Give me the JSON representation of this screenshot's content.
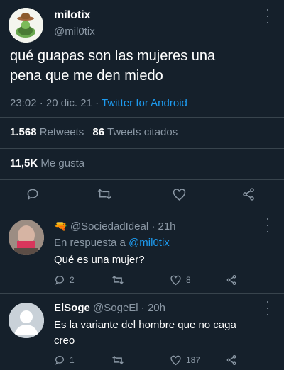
{
  "tweet": {
    "display_name": "milotix",
    "handle": "@mil0tix",
    "text_line1": "qué guapas son las mujeres una",
    "text_line2": "pena que me den miedo",
    "time": "23:02 · 20 dic. 21 ·",
    "source": "Twitter for Android",
    "retweets_count": "1.568",
    "retweets_label": "Retweets",
    "quotes_count": "86",
    "quotes_label": "Tweets citados",
    "likes_count": "11,5K",
    "likes_label": "Me gusta"
  },
  "replies": [
    {
      "display_name_emoji": "🔫",
      "handle_time": "@SociedadIdeal · 21h",
      "reply_prefix": "En respuesta a",
      "reply_to": "@mil0tix",
      "text": "Qué es una mujer?",
      "reply_count": "2",
      "like_count": "8"
    },
    {
      "display_name": "ElSoge",
      "handle_time": "@SogeEl · 20h",
      "text_line1": "Es la variante del hombre que no caga",
      "text_line2": "creo",
      "reply_count": "1",
      "like_count": "187"
    }
  ],
  "colors": {
    "background": "#15202b",
    "muted": "#8b98a5",
    "link": "#1d9bf0",
    "divider": "#38444d"
  }
}
